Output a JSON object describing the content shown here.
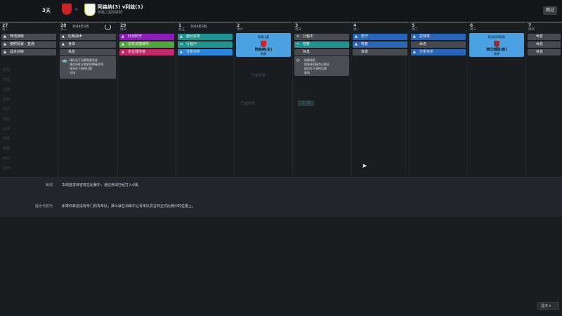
{
  "top": {
    "days": "3天",
    "vs": "v",
    "match_title": "阿森纳(3) v利兹(1)",
    "match_sub": "英格兰超级联赛",
    "skip": "跳过"
  },
  "month_labels": {
    "feb": "2024年2月",
    "mar": "2024年3月"
  },
  "days": [
    {
      "num": "27",
      "wd": "周二"
    },
    {
      "num": "28",
      "wd": "周三"
    },
    {
      "num": "29",
      "wd": "周四"
    },
    {
      "num": "1",
      "wd": "周五"
    },
    {
      "num": "2",
      "wd": "周六"
    },
    {
      "num": "3",
      "wd": "周日"
    },
    {
      "num": "4",
      "wd": "周一"
    },
    {
      "num": "5",
      "wd": "周二"
    },
    {
      "num": "6",
      "wd": "周三"
    },
    {
      "num": "7",
      "wd": "周四"
    }
  ],
  "sessions": {
    "d27": [
      "阵地演练",
      "按照情景 - 直通",
      "战术训练"
    ],
    "d28": [
      "比赛战术",
      "身体",
      "休息"
    ],
    "d29": [
      "针对防守",
      "进攻关键细节",
      "定位球传递"
    ],
    "d1": [
      "面对进攻",
      "行程中",
      "分析对手"
    ],
    "d3": [
      "行程中",
      "恢复",
      "休息"
    ],
    "d4": [
      "防守",
      "恢复",
      "休息"
    ],
    "d5": [
      "控球率",
      "休息",
      "分析对手"
    ],
    "d7": [
      "休息",
      "休息",
      "休息"
    ]
  },
  "match_d2": {
    "label": "联赛比赛",
    "team": "阿森纳(主)",
    "sub": "联赛"
  },
  "match_d6": {
    "label": "欧洲冠军联赛",
    "team": "西汉姆联(客)",
    "sub": "联赛"
  },
  "note_d28": "球队处于比赛准备状态\n通过训练计划安排预备队和\n球员在下周的比赛\n主场",
  "note_d3": "轮换球员\n恢复球员精力以保证\n球员在下周的比赛\n客场",
  "info": {
    "news_label": "新闻",
    "news_text": "本周首发阵容将在比赛中，通过传球已经打入4球。",
    "tips_label": "提示与技巧",
    "tips_text": "如果你目前没有专门的青年队，那么就在训练中让青年队员在非正式比赛中的位置上。"
  },
  "sort": "显示 ▾",
  "background_ghost": {
    "sidebar": [
      "概览",
      "日程",
      "比赛",
      "训练",
      "球员",
      "球队",
      "战术",
      "阵容",
      "数据",
      "转会",
      "财务",
      "俱乐部",
      "设置"
    ],
    "team_a": "巴塞罗那",
    "score": "1 - 0",
    "team_b": "巴塞罗那"
  },
  "colors": {
    "match_card": "#4aa0e0",
    "accent_blue": "#2a66b8",
    "purple": "#8a1fb8"
  }
}
